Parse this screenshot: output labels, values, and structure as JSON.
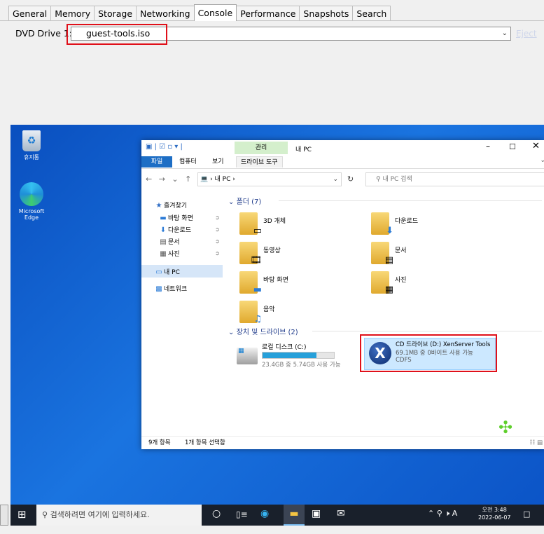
{
  "tabs": [
    "General",
    "Memory",
    "Storage",
    "Networking",
    "Console",
    "Performance",
    "Snapshots",
    "Search"
  ],
  "dvd": {
    "label": "DVD Drive 1:",
    "value": "guest-tools.iso",
    "eject": "Eject"
  },
  "desktop": {
    "recycle_bin": "휴지통",
    "edge": "Microsoft Edge"
  },
  "explorer": {
    "ribbon_context": "관리",
    "title": "내 PC",
    "ribbon_tabs": [
      "파일",
      "컴퓨터",
      "보기",
      "드라이브 도구"
    ],
    "address": "내 PC",
    "search_placeholder": "내 PC 검색",
    "sidebar": {
      "quick_access": "즐겨찾기",
      "quick_items": [
        "바탕 화면",
        "다운로드",
        "문서",
        "사진"
      ],
      "this_pc": "내 PC",
      "network": "네트워크"
    },
    "folders_header": "폴더 (7)",
    "folders": [
      "3D 개체",
      "다운로드",
      "동영상",
      "문서",
      "바탕 화면",
      "사진",
      "음악"
    ],
    "drives_header": "장치 및 드라이브 (2)",
    "drive_c": {
      "name": "로컬 디스크 (C:)",
      "free": "23.4GB 중 5.74GB 사용 가능",
      "used_fraction": 0.75
    },
    "drive_d": {
      "name": "CD 드라이브 (D:) XenServer Tools",
      "free": "69.1MB 중 0바이트 사용 가능",
      "fs": "CDFS"
    },
    "status": {
      "items": "9개 항목",
      "selected": "1개 항목 선택함"
    }
  },
  "taskbar": {
    "search_placeholder": "검색하려면 여기에 입력하세요.",
    "ime": "A",
    "time": "오전 3:48",
    "date": "2022-06-07"
  },
  "colors": {
    "highlight": "#e0101a",
    "desktop": "#1a74e0",
    "selection": "#cce8ff"
  }
}
